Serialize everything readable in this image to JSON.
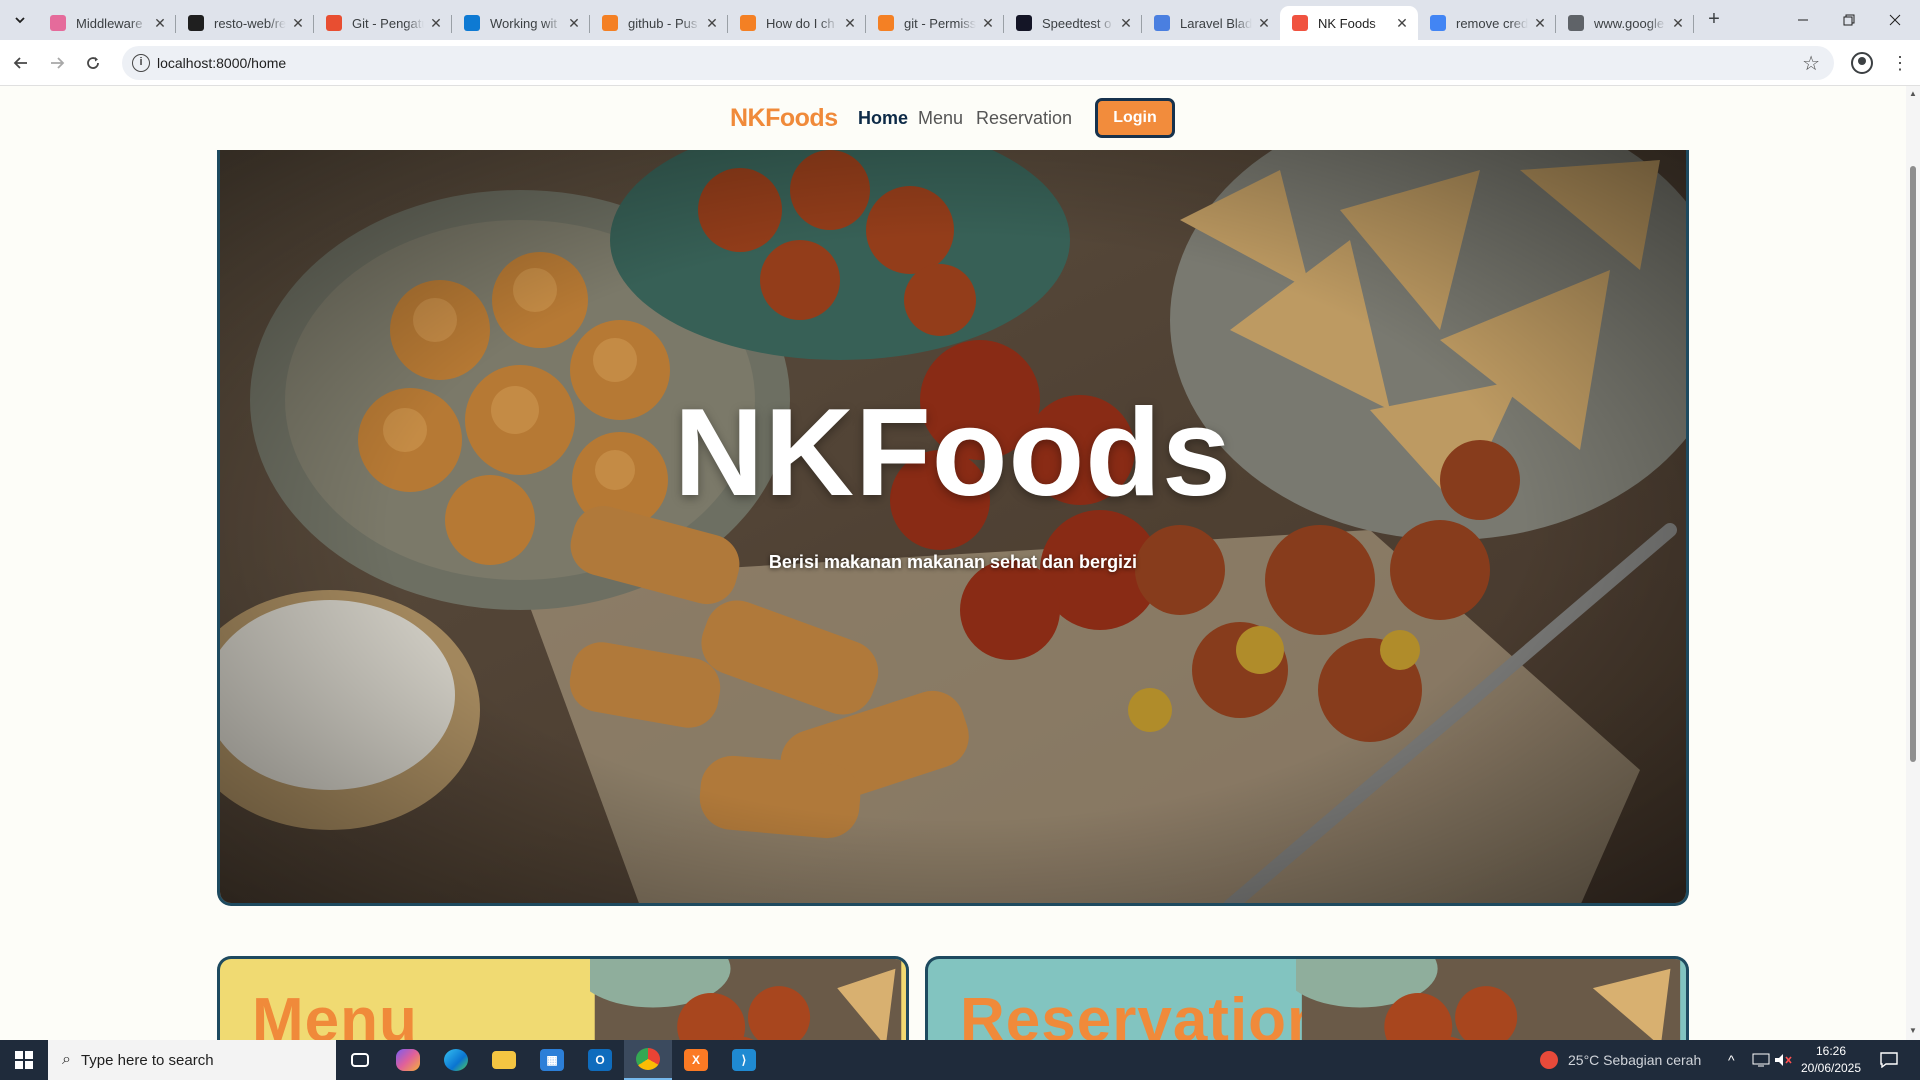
{
  "browser": {
    "tabs": [
      {
        "title": "Middleware",
        "icon": "middleware-favicon",
        "color": "#e56b9b"
      },
      {
        "title": "resto-web/re",
        "icon": "github-favicon",
        "color": "#1f1f1f"
      },
      {
        "title": "Git - Pengatu",
        "icon": "git-favicon",
        "color": "#e84e31"
      },
      {
        "title": "Working wit",
        "icon": "vscode-favicon",
        "color": "#0e7ad3"
      },
      {
        "title": "github - Pus",
        "icon": "stackoverflow-favicon",
        "color": "#f48024"
      },
      {
        "title": "How do I ch",
        "icon": "stackoverflow-favicon",
        "color": "#f48024"
      },
      {
        "title": "git - Permiss",
        "icon": "stackoverflow-favicon",
        "color": "#f48024"
      },
      {
        "title": "Speedtest o",
        "icon": "speedtest-favicon",
        "color": "#141526"
      },
      {
        "title": "Laravel Blad",
        "icon": "code-braces-favicon",
        "color": "#4a7fe0"
      },
      {
        "title": "NK Foods",
        "icon": "laravel-favicon",
        "color": "#f05340",
        "active": true
      },
      {
        "title": "remove cred",
        "icon": "google-favicon",
        "color": "#4285f4"
      },
      {
        "title": "www.google",
        "icon": "globe-favicon",
        "color": "#5f6368"
      }
    ],
    "url": "localhost:8000/home"
  },
  "site": {
    "brand": "NKFoods",
    "nav": [
      {
        "label": "Home",
        "active": true
      },
      {
        "label": "Menu",
        "active": false
      },
      {
        "label": "Reservation",
        "active": false
      }
    ],
    "login_label": "Login",
    "hero": {
      "title": "NKFoods",
      "subtitle": "Berisi makanan makanan sehat dan bergizi"
    },
    "cards": [
      {
        "title": "Menu",
        "color": "#f0da72"
      },
      {
        "title": "Reservation",
        "color": "#82c4c0"
      }
    ],
    "colors": {
      "accent": "#f08a3a",
      "navy": "#0d2a47",
      "border": "#1e4a5f"
    }
  },
  "taskbar": {
    "search_placeholder": "Type here to search",
    "weather": "25°C  Sebagian cerah",
    "time": "16:26",
    "date": "20/06/2025"
  }
}
